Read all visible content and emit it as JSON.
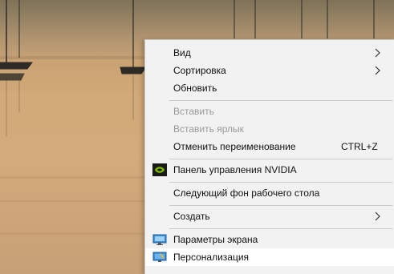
{
  "menu": {
    "items": [
      {
        "label": "Вид",
        "submenu": true
      },
      {
        "label": "Сортировка",
        "submenu": true
      },
      {
        "label": "Обновить"
      },
      {
        "label": "Вставить",
        "disabled": true
      },
      {
        "label": "Вставить ярлык",
        "disabled": true
      },
      {
        "label": "Отменить переименование",
        "shortcut": "CTRL+Z"
      },
      {
        "label": "Панель управления NVIDIA",
        "icon": "nvidia-icon"
      },
      {
        "label": "Следующий фон рабочего стола"
      },
      {
        "label": "Создать",
        "submenu": true
      },
      {
        "label": "Параметры экрана",
        "icon": "display-icon"
      },
      {
        "label": "Персонализация",
        "icon": "personalize-icon",
        "hovered": true
      }
    ]
  },
  "colors": {
    "menu_background": "#f2f2f2",
    "disabled_text": "#9a9a9a",
    "separator": "#c9c9c9",
    "nvidia_green": "#76b900"
  }
}
